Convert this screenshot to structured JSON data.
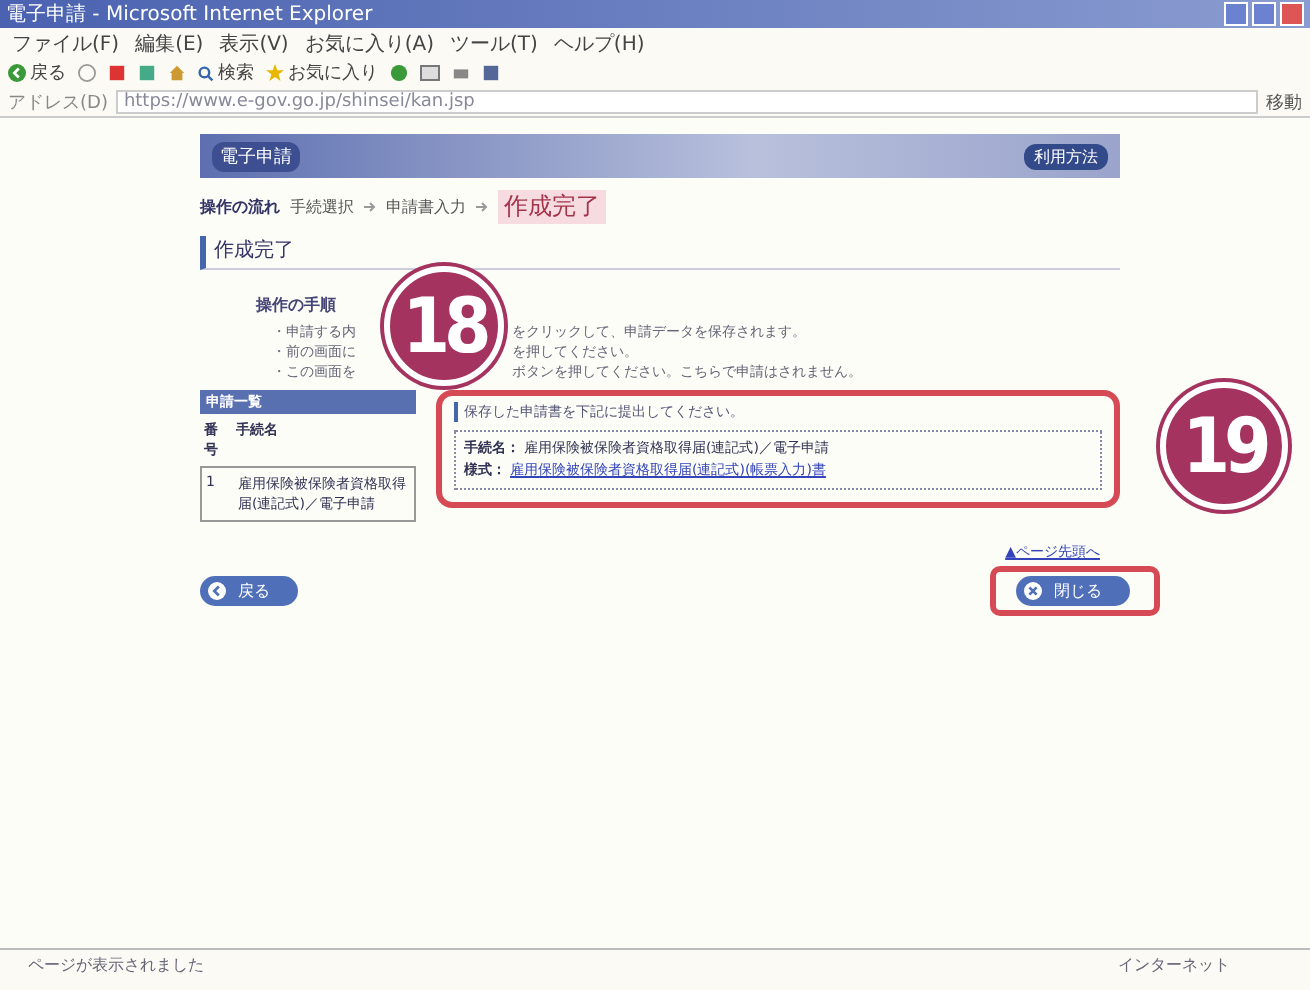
{
  "window": {
    "title": "電子申請 - Microsoft Internet Explorer"
  },
  "menu": [
    "ファイル(F)",
    "編集(E)",
    "表示(V)",
    "お気に入り(A)",
    "ツール(T)",
    "ヘルプ(H)"
  ],
  "toolbar": {
    "back": "戻る",
    "search": "検索",
    "favorites": "お気に入り"
  },
  "address": {
    "label": "アドレス(D)",
    "url": "https://www.e-gov.go.jp/shinsei/kan.jsp",
    "go": "移動"
  },
  "header": {
    "logo": "電子申請",
    "help": "利用方法"
  },
  "flow": {
    "label": "操作の流れ",
    "steps": [
      {
        "label": "手続選択",
        "selected": false
      },
      {
        "label": "申請書入力",
        "selected": false
      },
      {
        "label": "作成完了",
        "selected": true
      }
    ]
  },
  "section_title": "作成完了",
  "instructions": {
    "title": "操作の手順",
    "items": [
      {
        "left": "・申請する内",
        "right": "をクリックして、申請データを保存されます。"
      },
      {
        "left": "・前の画面に",
        "right": "を押してください。"
      },
      {
        "left": "・この画面を",
        "right": "ボタンを押してください。こちらで申請はされません。"
      }
    ]
  },
  "list": {
    "title": "申請一覧",
    "columns": [
      "番号",
      "手続名"
    ],
    "rows": [
      [
        "1",
        "雇用保険被保険者資格取得届(連記式)／電子申請"
      ]
    ]
  },
  "message": "保存した申請書を下記に提出してください。",
  "detail": [
    {
      "label": "手続名：",
      "value": "雇用保険被保険者資格取得届(連記式)／電子申請",
      "link": false
    },
    {
      "label": "様式：",
      "value": "雇用保険被保険者資格取得届(連記式)(帳票入力)書",
      "link": true
    }
  ],
  "top_link": "▲ページ先頭へ",
  "buttons": {
    "back": "戻る",
    "close": "閉じる"
  },
  "callouts": [
    "18",
    "19"
  ],
  "status": {
    "text": "ページが表示されました",
    "zone": "インターネット"
  }
}
